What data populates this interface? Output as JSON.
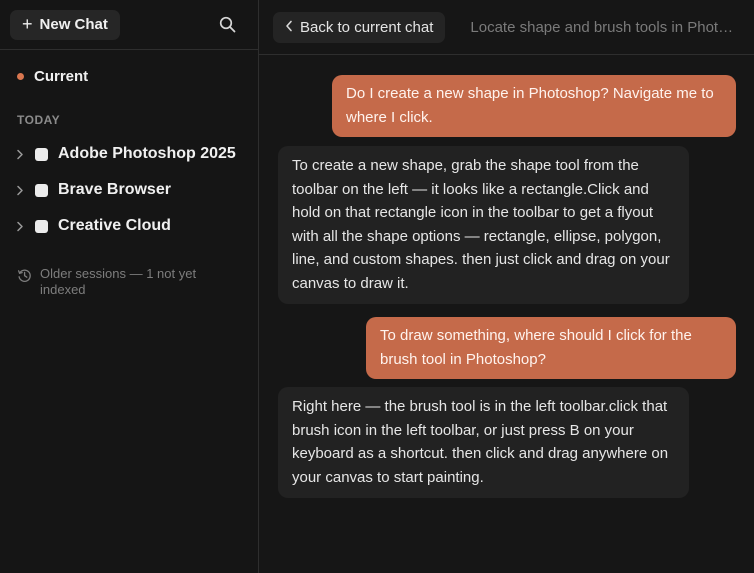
{
  "sidebar": {
    "new_chat_label": "New Chat",
    "current_label": "Current",
    "section_label": "TODAY",
    "groups": [
      {
        "label": "Adobe Photoshop 2025"
      },
      {
        "label": "Brave Browser"
      },
      {
        "label": "Creative Cloud"
      }
    ],
    "older_sessions": "Older sessions — 1 not yet indexed"
  },
  "header": {
    "back_label": "Back to current chat",
    "chat_title": "Locate shape and brush tools in Photoshop"
  },
  "messages": [
    {
      "role": "user",
      "text": "Do I create a new shape in Photoshop? Navigate me to where I click."
    },
    {
      "role": "assistant",
      "text": "To create a new shape, grab the shape tool from the toolbar on the left — it looks like a rectangle.Click and hold on that rectangle icon in the toolbar to get a flyout with all the shape options — rectangle, ellipse, polygon, line, and custom shapes. then just click and drag on your canvas to draw it."
    },
    {
      "role": "user",
      "text": "To draw something, where should I click for the brush tool in Photoshop?"
    },
    {
      "role": "assistant",
      "text": "Right here — the brush tool is in the left toolbar.click that brush icon in the left toolbar, or just press B on your keyboard as a shortcut. then click and drag anywhere on your canvas to start painting."
    }
  ],
  "colors": {
    "user_bubble": "#c56a4a",
    "assistant_bubble": "#222222",
    "accent_dot": "#d9764f"
  },
  "icons": {
    "new_chat": "plus-icon",
    "search": "search-icon",
    "group_expand": "chevron-right-icon",
    "back": "chevron-left-icon",
    "older_sessions": "history-icon"
  }
}
